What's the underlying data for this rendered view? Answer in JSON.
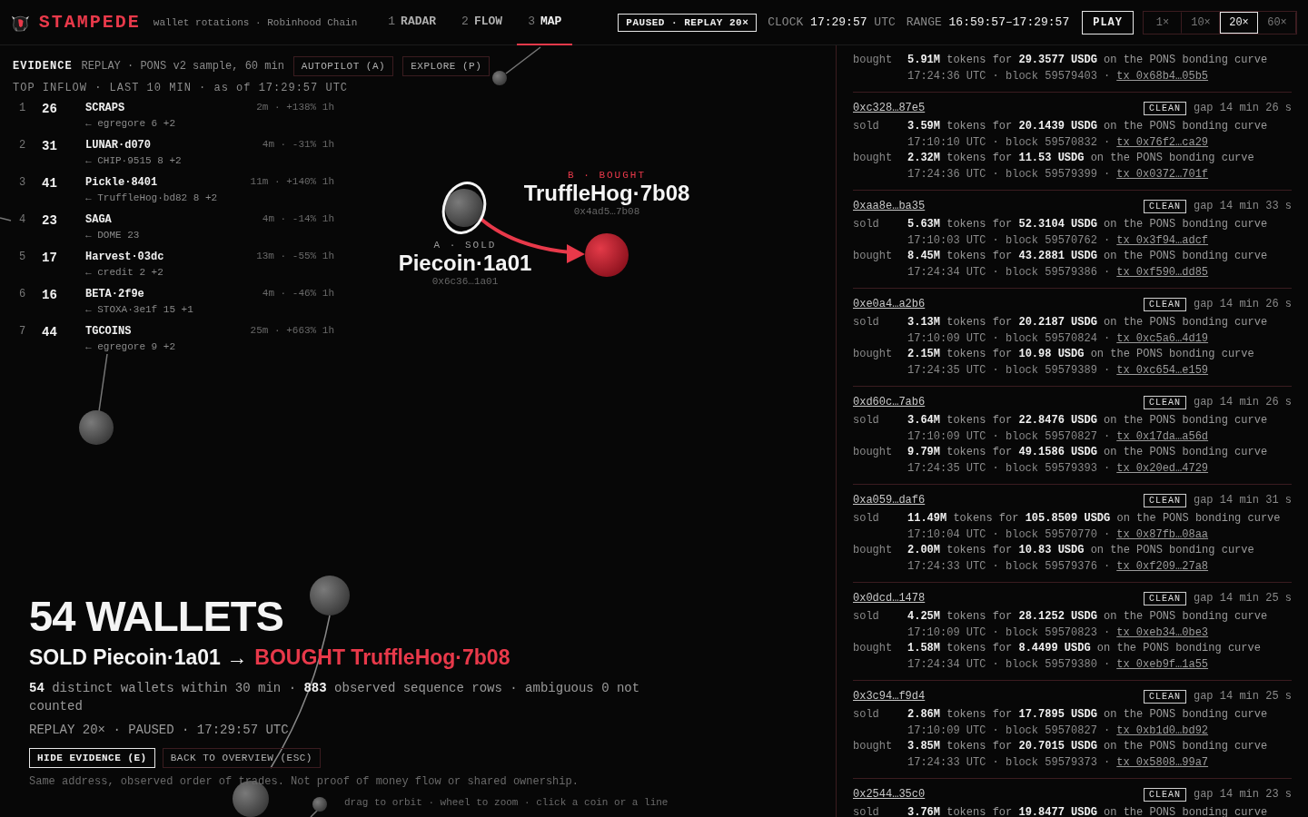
{
  "header": {
    "brand": "STAMPEDE",
    "subtitle": "wallet rotations · Robinhood Chain",
    "tabs": [
      {
        "number": "1",
        "label": "RADAR",
        "selected": false
      },
      {
        "number": "2",
        "label": "FLOW",
        "selected": false
      },
      {
        "number": "3",
        "label": "MAP",
        "selected": true
      }
    ],
    "status": "PAUSED · REPLAY 20×",
    "clock_label": "CLOCK",
    "clock": "17:29:57",
    "clock_unit": "UTC",
    "range_label": "RANGE",
    "range": "16:59:57–17:29:57",
    "play": "PLAY",
    "speeds": [
      {
        "label": "1×",
        "selected": false
      },
      {
        "label": "10×",
        "selected": false
      },
      {
        "label": "20×",
        "selected": true
      },
      {
        "label": "60×",
        "selected": false
      }
    ]
  },
  "evidence": {
    "title": "EVIDENCE",
    "source": "REPLAY · PONS v2 sample, 60 min",
    "buttons": [
      "AUTOPILOT (A)",
      "EXPLORE (P)"
    ],
    "list_title": "TOP INFLOW · LAST 10 MIN · as of 17:29:57 UTC",
    "rows": [
      {
        "rank": "1",
        "count": "26",
        "name": "SCRAPS",
        "from": "← egregore 6 +2",
        "stats": "2m · +138% 1h"
      },
      {
        "rank": "2",
        "count": "31",
        "name": "LUNAR·d070",
        "from": "← CHIP·9515 8 +2",
        "stats": "4m · -31% 1h"
      },
      {
        "rank": "3",
        "count": "41",
        "name": "Pickle·8401",
        "from": "← TruffleHog·bd82 8 +2",
        "stats": "11m · +140% 1h"
      },
      {
        "rank": "4",
        "count": "23",
        "name": "SAGA",
        "from": "← DOME 23",
        "stats": "4m · -14% 1h"
      },
      {
        "rank": "5",
        "count": "17",
        "name": "Harvest·03dc",
        "from": "← credit 2 +2",
        "stats": "13m · -55% 1h"
      },
      {
        "rank": "6",
        "count": "16",
        "name": "BETA·2f9e",
        "from": "← STOXA·3e1f 15 +1",
        "stats": "4m · -46% 1h"
      },
      {
        "rank": "7",
        "count": "44",
        "name": "TGCOINS",
        "from": "← egregore 9 +2",
        "stats": "25m · +663% 1h"
      }
    ]
  },
  "map": {
    "source": {
      "tag": "A · SOLD",
      "name": "Piecoin·1a01",
      "address": "0x6c36…1a01"
    },
    "target": {
      "tag": "B · BOUGHT",
      "name": "TruffleHog·7b08",
      "address": "0x4ad5…7b08"
    },
    "hint": "drag to orbit · wheel to zoom · click a coin or a line"
  },
  "summary": {
    "headline": "54 WALLETS",
    "sold": "SOLD Piecoin·1a01 →",
    "bought": "BOUGHT TruffleHog·7b08",
    "detail": "**54** distinct wallets within 30 min · **883** observed sequence rows · ambiguous 0 not counted",
    "replay": "REPLAY 20× · PAUSED · 17:29:57 UTC",
    "buttons": [
      {
        "label": "HIDE EVIDENCE (E)",
        "primary": true
      },
      {
        "label": "BACK TO OVERVIEW (ESC)",
        "primary": false
      }
    ],
    "disclaimer": "Same address, observed order of trades. Not proof of money flow or shared ownership."
  },
  "wallets": [
    {
      "trades": [
        {
          "side": "bought",
          "amount": "**5.91M** tokens for **29.3577 USDG** on the PONS bonding curve",
          "meta": "17:24:36 UTC · block 59579403 ·",
          "tx": "tx 0x68b4…05b5"
        }
      ]
    },
    {
      "address": "0xc328…87e5",
      "badge": "CLEAN",
      "gap": "gap 14 min 26 s",
      "trades": [
        {
          "side": "sold",
          "amount": "**3.59M** tokens for **20.1439 USDG** on the PONS bonding curve",
          "meta": "17:10:10 UTC · block 59570832 ·",
          "tx": "tx 0x76f2…ca29"
        },
        {
          "side": "bought",
          "amount": "**2.32M** tokens for **11.53 USDG** on the PONS bonding curve",
          "meta": "17:24:36 UTC · block 59579399 ·",
          "tx": "tx 0x0372…701f"
        }
      ]
    },
    {
      "address": "0xaa8e…ba35",
      "badge": "CLEAN",
      "gap": "gap 14 min 33 s",
      "trades": [
        {
          "side": "sold",
          "amount": "**5.63M** tokens for **52.3104 USDG** on the PONS bonding curve",
          "meta": "17:10:03 UTC · block 59570762 ·",
          "tx": "tx 0x3f94…adcf"
        },
        {
          "side": "bought",
          "amount": "**8.45M** tokens for **43.2881 USDG** on the PONS bonding curve",
          "meta": "17:24:34 UTC · block 59579386 ·",
          "tx": "tx 0xf590…dd85"
        }
      ]
    },
    {
      "address": "0xe0a4…a2b6",
      "badge": "CLEAN",
      "gap": "gap 14 min 26 s",
      "trades": [
        {
          "side": "sold",
          "amount": "**3.13M** tokens for **20.2187 USDG** on the PONS bonding curve",
          "meta": "17:10:09 UTC · block 59570824 ·",
          "tx": "tx 0xc5a6…4d19"
        },
        {
          "side": "bought",
          "amount": "**2.15M** tokens for **10.98 USDG** on the PONS bonding curve",
          "meta": "17:24:35 UTC · block 59579389 ·",
          "tx": "tx 0xc654…e159"
        }
      ]
    },
    {
      "address": "0xd60c…7ab6",
      "badge": "CLEAN",
      "gap": "gap 14 min 26 s",
      "trades": [
        {
          "side": "sold",
          "amount": "**3.64M** tokens for **22.8476 USDG** on the PONS bonding curve",
          "meta": "17:10:09 UTC · block 59570827 ·",
          "tx": "tx 0x17da…a56d"
        },
        {
          "side": "bought",
          "amount": "**9.79M** tokens for **49.1586 USDG** on the PONS bonding curve",
          "meta": "17:24:35 UTC · block 59579393 ·",
          "tx": "tx 0x20ed…4729"
        }
      ]
    },
    {
      "address": "0xa059…daf6",
      "badge": "CLEAN",
      "gap": "gap 14 min 31 s",
      "trades": [
        {
          "side": "sold",
          "amount": "**11.49M** tokens for **105.8509 USDG** on the PONS bonding curve",
          "meta": "17:10:04 UTC · block 59570770 ·",
          "tx": "tx 0x87fb…08aa"
        },
        {
          "side": "bought",
          "amount": "**2.00M** tokens for **10.83 USDG** on the PONS bonding curve",
          "meta": "17:24:33 UTC · block 59579376 ·",
          "tx": "tx 0xf209…27a8"
        }
      ]
    },
    {
      "address": "0x0dcd…1478",
      "badge": "CLEAN",
      "gap": "gap 14 min 25 s",
      "trades": [
        {
          "side": "sold",
          "amount": "**4.25M** tokens for **28.1252 USDG** on the PONS bonding curve",
          "meta": "17:10:09 UTC · block 59570823 ·",
          "tx": "tx 0xeb34…0be3"
        },
        {
          "side": "bought",
          "amount": "**1.58M** tokens for **8.4499 USDG** on the PONS bonding curve",
          "meta": "17:24:34 UTC · block 59579380 ·",
          "tx": "tx 0xeb9f…1a55"
        }
      ]
    },
    {
      "address": "0x3c94…f9d4",
      "badge": "CLEAN",
      "gap": "gap 14 min 25 s",
      "trades": [
        {
          "side": "sold",
          "amount": "**2.86M** tokens for **17.7895 USDG** on the PONS bonding curve",
          "meta": "17:10:09 UTC · block 59570827 ·",
          "tx": "tx 0xb1d0…bd92"
        },
        {
          "side": "bought",
          "amount": "**3.85M** tokens for **20.7015 USDG** on the PONS bonding curve",
          "meta": "17:24:33 UTC · block 59579373 ·",
          "tx": "tx 0x5808…99a7"
        }
      ]
    },
    {
      "address": "0x2544…35c0",
      "badge": "CLEAN",
      "gap": "gap 14 min 23 s",
      "trades": [
        {
          "side": "sold",
          "amount": "**3.76M** tokens for **19.8477 USDG** on the PONS bonding curve"
        }
      ]
    }
  ]
}
